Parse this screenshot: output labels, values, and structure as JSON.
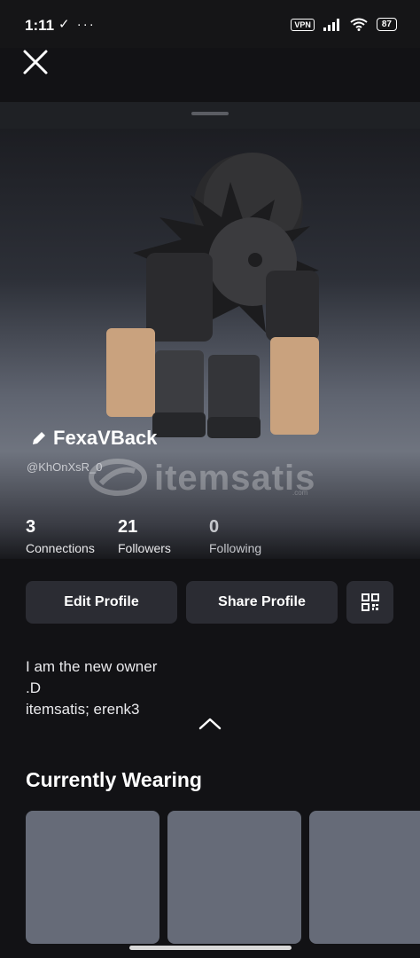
{
  "status_bar": {
    "time": "1:11",
    "left_icons": "✓ ···",
    "vpn": "VPN",
    "battery": "87"
  },
  "profile": {
    "display_name": "FexaVBack",
    "username": "@KhOnXsR_0",
    "watermark": "itemsatis",
    "watermark_small": ".com"
  },
  "stats": [
    {
      "count": "3",
      "label": "Connections"
    },
    {
      "count": "21",
      "label": "Followers"
    },
    {
      "count": "0",
      "label": "Following"
    }
  ],
  "buttons": {
    "edit": "Edit Profile",
    "share": "Share Profile"
  },
  "bio": {
    "lines": [
      "I am the new owner",
      ".D",
      "itemsatis; erenk3"
    ]
  },
  "currently_wearing": {
    "title": "Currently Wearing"
  },
  "icons": {
    "close": "close-icon",
    "pencil": "pencil-icon",
    "qr": "qr-code-icon",
    "chevron": "chevron-up-icon"
  }
}
